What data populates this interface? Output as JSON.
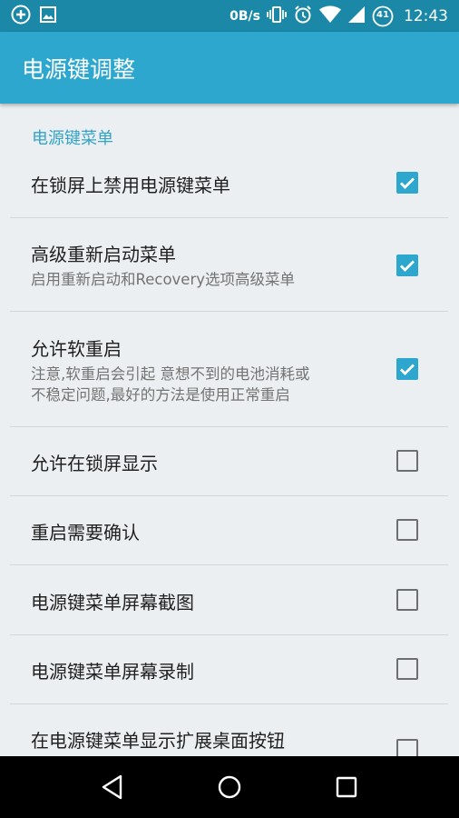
{
  "status_bar": {
    "net_speed": "0B/s",
    "battery_level": "41",
    "time": "12:43",
    "icons": [
      "add-circle-icon",
      "image-icon",
      "vibrate-icon",
      "alarm-icon",
      "wifi-icon",
      "cell-signal-icon",
      "battery-icon"
    ]
  },
  "app_bar": {
    "title": "电源键调整"
  },
  "section": {
    "header": "电源键菜单"
  },
  "items": [
    {
      "title": "在锁屏上禁用电源键菜单",
      "checked": true
    },
    {
      "title": "高级重新启动菜单",
      "summary": "启用重新启动和Recovery选项高级菜单",
      "checked": true
    },
    {
      "title": "允许软重启",
      "summary_line1": "注意,软重启会引起 意想不到的电池消耗或",
      "summary_line2": "不稳定问题,最好的方法是使用正常重启",
      "checked": true
    },
    {
      "title": "允许在锁屏显示",
      "checked": false
    },
    {
      "title": "重启需要确认",
      "checked": false
    },
    {
      "title": "电源键菜单屏幕截图",
      "checked": false
    },
    {
      "title": "电源键菜单屏幕录制",
      "checked": false
    },
    {
      "title": "在电源键菜单显示扩展桌面按钮",
      "checked": false
    }
  ],
  "colors": {
    "status_bar": "#1b88a8",
    "app_bar": "#2ea7cf",
    "accent": "#2ea7cf",
    "background": "#eceff1"
  },
  "nav_bar": {
    "icons": [
      "back-icon",
      "home-icon",
      "recents-icon"
    ]
  }
}
